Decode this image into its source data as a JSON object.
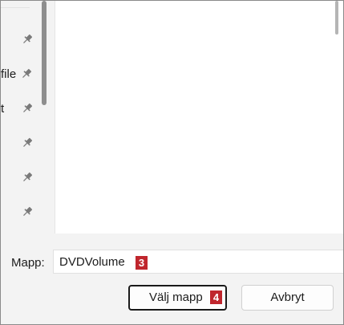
{
  "nav": {
    "items": [
      {
        "label": "",
        "icon": "pin-icon"
      },
      {
        "label": "file",
        "icon": "pin-icon"
      },
      {
        "label": "t",
        "icon": "pin-icon"
      },
      {
        "label": "",
        "icon": "pin-icon"
      },
      {
        "label": "",
        "icon": "pin-icon"
      },
      {
        "label": "",
        "icon": "pin-icon"
      }
    ]
  },
  "footer": {
    "folder_label": "Mapp:",
    "folder_value": "DVDVolume",
    "folder_step": "3",
    "select_button": "Välj mapp",
    "select_step": "4",
    "cancel_button": "Avbryt"
  },
  "colors": {
    "step_badge": "#c0262d",
    "pane_background": "#f3f3f3",
    "content_background": "#ffffff"
  }
}
